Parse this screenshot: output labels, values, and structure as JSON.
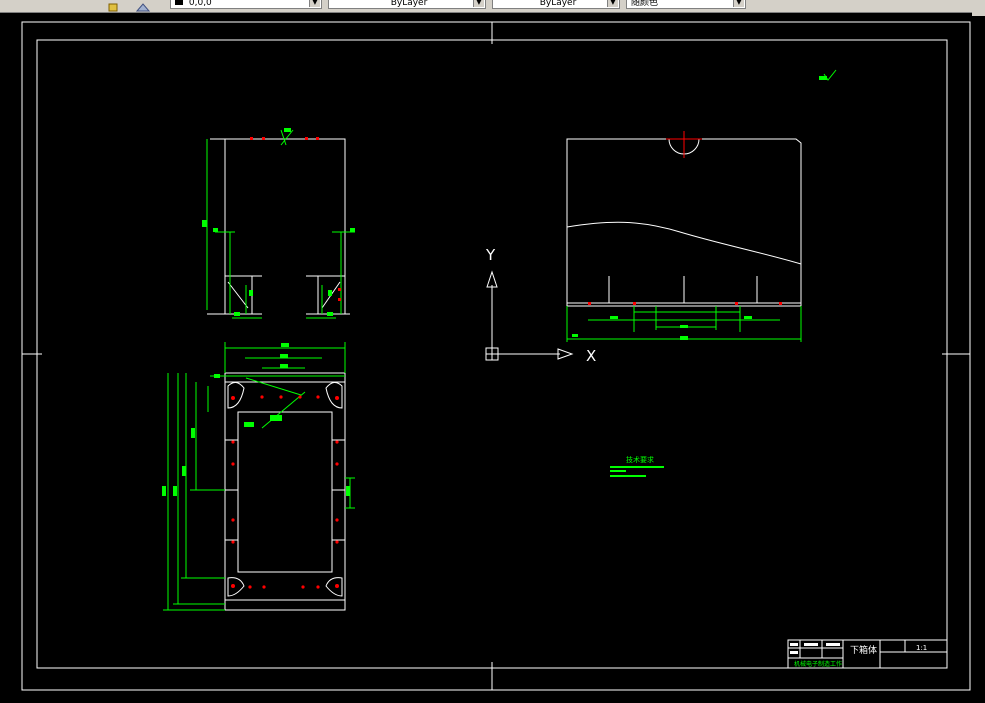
{
  "toolbar": {
    "color_control": "0,0,0",
    "linetype_control": "ByLayer",
    "lineweight_control": "ByLayer",
    "plotstyle_control": "随颜色"
  },
  "drawing": {
    "ucs_x_label": "X",
    "ucs_y_label": "Y",
    "title_block_name": "下箱体",
    "title_block_school": "机械电子制造工作",
    "title_block_scale": "1:1",
    "tech_requirements_title": "技术要求"
  },
  "colors": {
    "background": "#000000",
    "geometry": "#ffffff",
    "dimension": "#00ff00",
    "holes": "#ff0000"
  }
}
